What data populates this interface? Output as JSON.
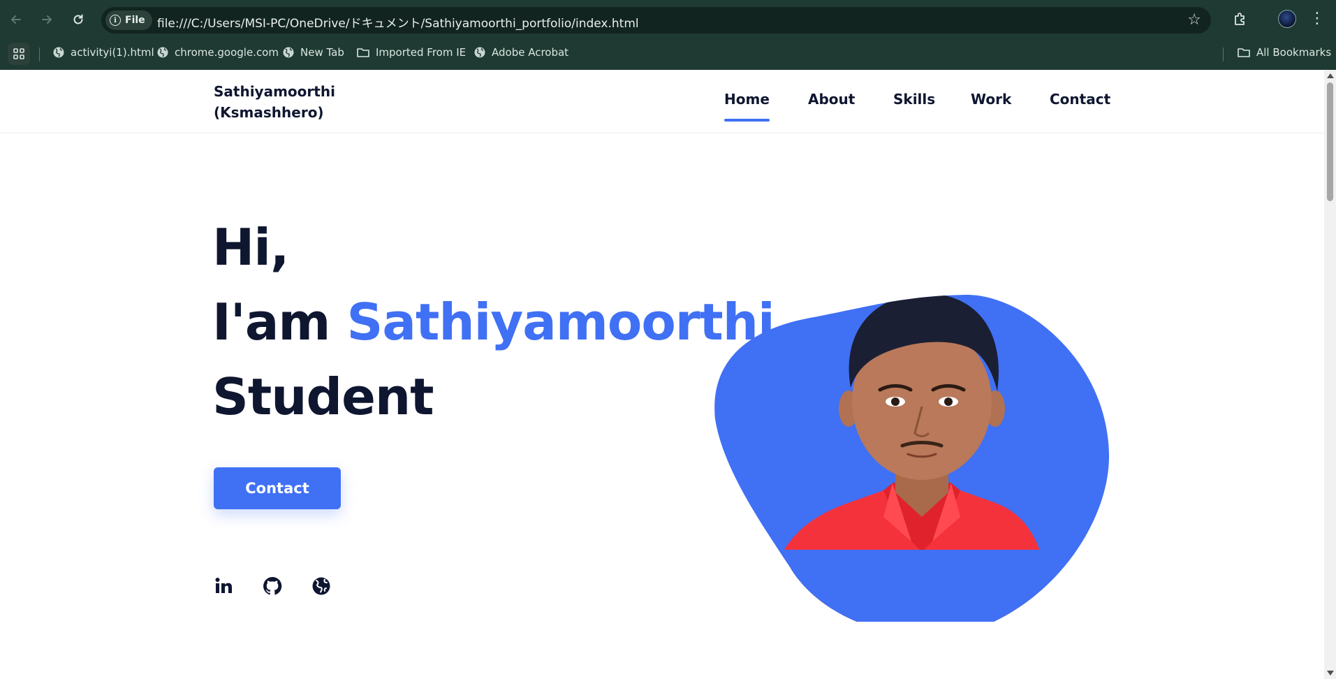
{
  "browser": {
    "url_chip": "File",
    "url": "file:///C:/Users/MSI-PC/OneDrive/ドキュメント/Sathiyamoorthi_portfolio/index.html",
    "bookmarks": [
      {
        "label": "activityi(1).html",
        "icon": "globe-icon"
      },
      {
        "label": "chrome.google.com",
        "icon": "globe-icon"
      },
      {
        "label": "New Tab",
        "icon": "globe-icon"
      },
      {
        "label": "Imported From IE",
        "icon": "folder-icon"
      },
      {
        "label": "Adobe Acrobat",
        "icon": "globe-icon"
      }
    ],
    "all_bookmarks": "All Bookmarks"
  },
  "site": {
    "brand_line1": "Sathiyamoorthi",
    "brand_line2": "(Ksmashhero)",
    "nav": [
      {
        "label": "Home",
        "active": true
      },
      {
        "label": "About",
        "active": false
      },
      {
        "label": "Skills",
        "active": false
      },
      {
        "label": "Work",
        "active": false
      },
      {
        "label": "Contact",
        "active": false
      }
    ],
    "hero": {
      "line1": "Hi,",
      "line2_prefix": "I'am ",
      "line2_name": "Sathiyamoorthi",
      "line3": "Student",
      "button": "Contact"
    },
    "social_icons": [
      "linkedin-icon",
      "github-icon",
      "globe-icon"
    ],
    "colors": {
      "accent": "#4070f4",
      "text": "#0e1630",
      "chrome_bg": "#1e3a32",
      "shirt": "#f4323c"
    }
  }
}
